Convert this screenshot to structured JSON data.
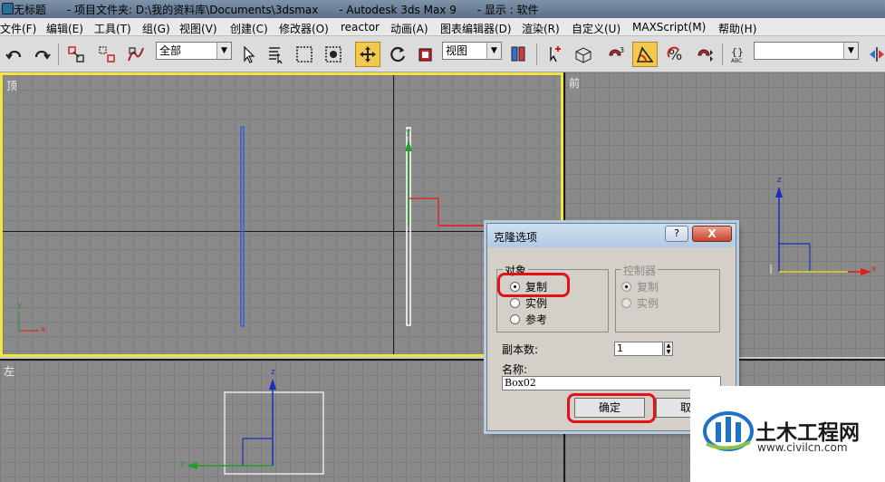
{
  "window": {
    "title": "无标题      - 项目文件夹: D:\\我的资料库\\Documents\\3dsmax      - Autodesk 3ds Max 9      - 显示 : 软件"
  },
  "menu": [
    "文件(F)",
    "编辑(E)",
    "工具(T)",
    "组(G)",
    "视图(V)",
    "创建(C)",
    "修改器(O)",
    "reactor",
    "动画(A)",
    "图表编辑器(D)",
    "渲染(R)",
    "自定义(U)",
    "MAXScript(M)",
    "帮助(H)"
  ],
  "toolbar": {
    "selection_filter": "全部",
    "reference_coord": "视图",
    "named_selection": ""
  },
  "viewports": {
    "top": "顶",
    "front": "前",
    "left": "左"
  },
  "axes": {
    "x": "x",
    "y": "y",
    "z": "z"
  },
  "clone_dialog": {
    "title": "克隆选项",
    "help": "?",
    "close": "X",
    "object_group": "对象",
    "copy": "复制",
    "instance": "实例",
    "reference": "参考",
    "controller_group": "控制器",
    "ctrl_copy": "复制",
    "ctrl_instance": "实例",
    "copies_label": "副本数:",
    "copies_value": "1",
    "name_label": "名称:",
    "name_value": "Box02",
    "ok": "确定",
    "cancel": "取消"
  },
  "watermark": {
    "brand": "土木工程网",
    "url": "www.civilcn.com"
  },
  "colors": {
    "active_viewport": "#f2e542",
    "highlight": "#e1121a",
    "axis_x": "#e41b17",
    "axis_y": "#1f9c2a",
    "axis_z": "#1a2dbb",
    "box_line": "#3a5ad6"
  }
}
